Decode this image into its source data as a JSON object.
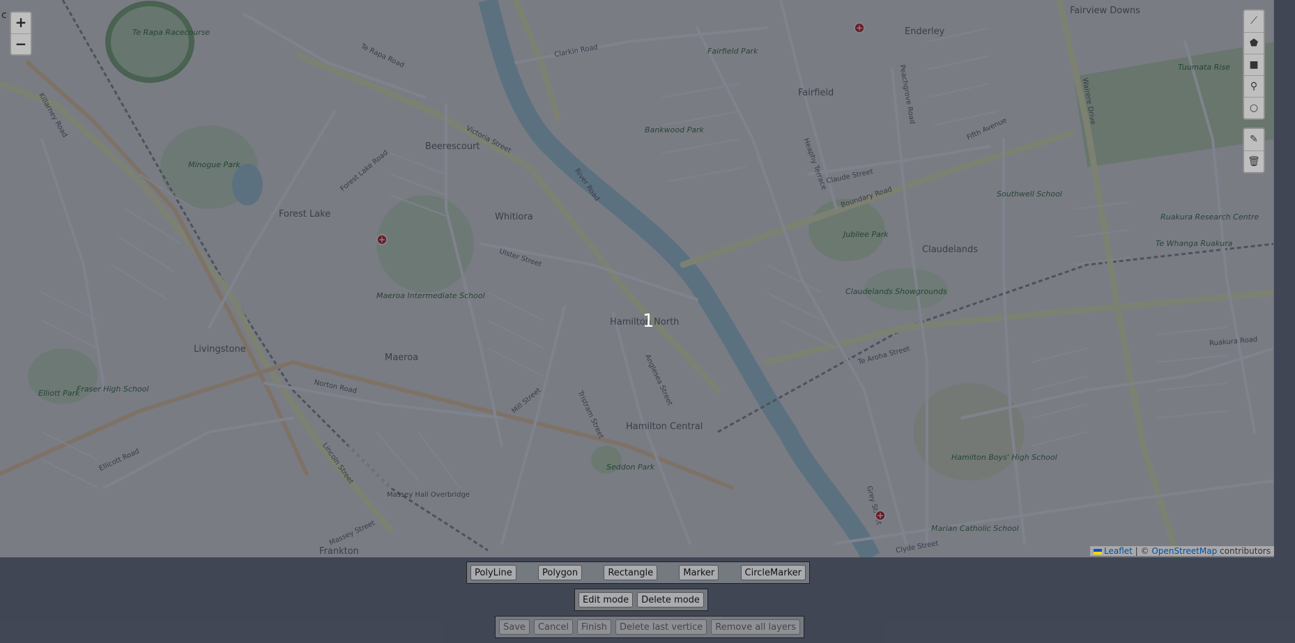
{
  "map": {
    "zoom_in_label": "+",
    "zoom_out_label": "−",
    "edge_letter": "c",
    "center_number": "1",
    "labels": {
      "suburbs": [
        "Fairview Downs",
        "Enderley",
        "Fairfield",
        "Beerescourt",
        "Forest Lake",
        "Whitiora",
        "Claudelands",
        "Hamilton North",
        "Livingstone",
        "Maeroa",
        "Hamilton Central",
        "Frankton",
        "Massey Hall Overbridge"
      ],
      "parks": [
        "Te Rapa Racecourse",
        "Minogue Park",
        "Jubilee Park",
        "Claudelands Showgrounds",
        "Tuumata Rise",
        "Ruakura Research Centre",
        "Hamilton Boys' High School",
        "Maeroa Intermediate School",
        "Fraser High School",
        "Marian Catholic School",
        "Southwell School",
        "Elliott Park",
        "Seddon Park",
        "Fairfield Park",
        "Bankwood Park",
        "Te Whanga Ruakura"
      ],
      "roads": [
        "Te Rapa Road",
        "Victoria Street",
        "Boundary Road",
        "Clarkin Road",
        "Ulster Street",
        "Norton Road",
        "Mill Street",
        "Grey Street",
        "Peachgrove Road",
        "Wairere Drive",
        "Ruakura Road",
        "Te Aroha Street",
        "Lincoln Street",
        "Massey Street",
        "Ellicott Road",
        "Killarney Road",
        "Forest Lake Road",
        "Heaphy Terrace",
        "River Road",
        "Claude Street",
        "Fifth Avenue",
        "Anglesea Street",
        "Tristram Street",
        "Clyde Street"
      ]
    },
    "attribution": {
      "leaflet": "Leaflet",
      "separator": " | © ",
      "osm": "OpenStreetMap",
      "suffix": " contributors"
    }
  },
  "draw_toolbar": {
    "draw_tools": [
      {
        "name": "polyline-tool",
        "glyph": "⟋"
      },
      {
        "name": "polygon-tool",
        "glyph": "⬟"
      },
      {
        "name": "rectangle-tool",
        "glyph": "■"
      },
      {
        "name": "marker-tool",
        "glyph": "⚲"
      },
      {
        "name": "circle-tool",
        "glyph": "○"
      }
    ],
    "edit_tools": [
      {
        "name": "edit-layers-tool",
        "glyph": "✎"
      },
      {
        "name": "delete-layers-tool",
        "glyph": "🗑"
      }
    ]
  },
  "controls": {
    "draw_buttons": [
      "PolyLine",
      "Polygon",
      "Rectangle",
      "Marker",
      "CircleMarker"
    ],
    "mode_buttons": [
      "Edit mode",
      "Delete mode"
    ],
    "action_buttons": [
      "Save",
      "Cancel",
      "Finish",
      "Delete last vertice",
      "Remove all layers"
    ]
  }
}
